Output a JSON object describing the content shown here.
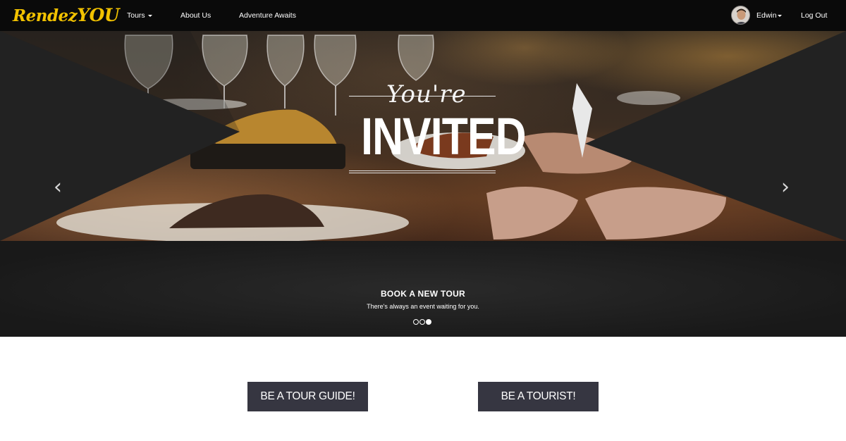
{
  "brand": {
    "part1": "Rendez",
    "part2": "YOU"
  },
  "nav": {
    "tours": "Tours",
    "about": "About Us",
    "adventure": "Adventure Awaits",
    "user": "Edwin",
    "logout": "Log Out"
  },
  "hero": {
    "script_text": "You're",
    "big_text": "INVITED",
    "caption_title": "BOOK A NEW TOUR",
    "caption_sub": "There's always an event waiting for you.",
    "prev_icon": "chevron-left-icon",
    "next_icon": "chevron-right-icon",
    "slide_count": 3,
    "active_slide": 3
  },
  "cta": {
    "guide": "BE A TOUR GUIDE!",
    "tourist": "BE A TOURIST!"
  },
  "colors": {
    "brand": "#f2c200",
    "navbar": "#0a0a0a",
    "button": "#363641"
  }
}
